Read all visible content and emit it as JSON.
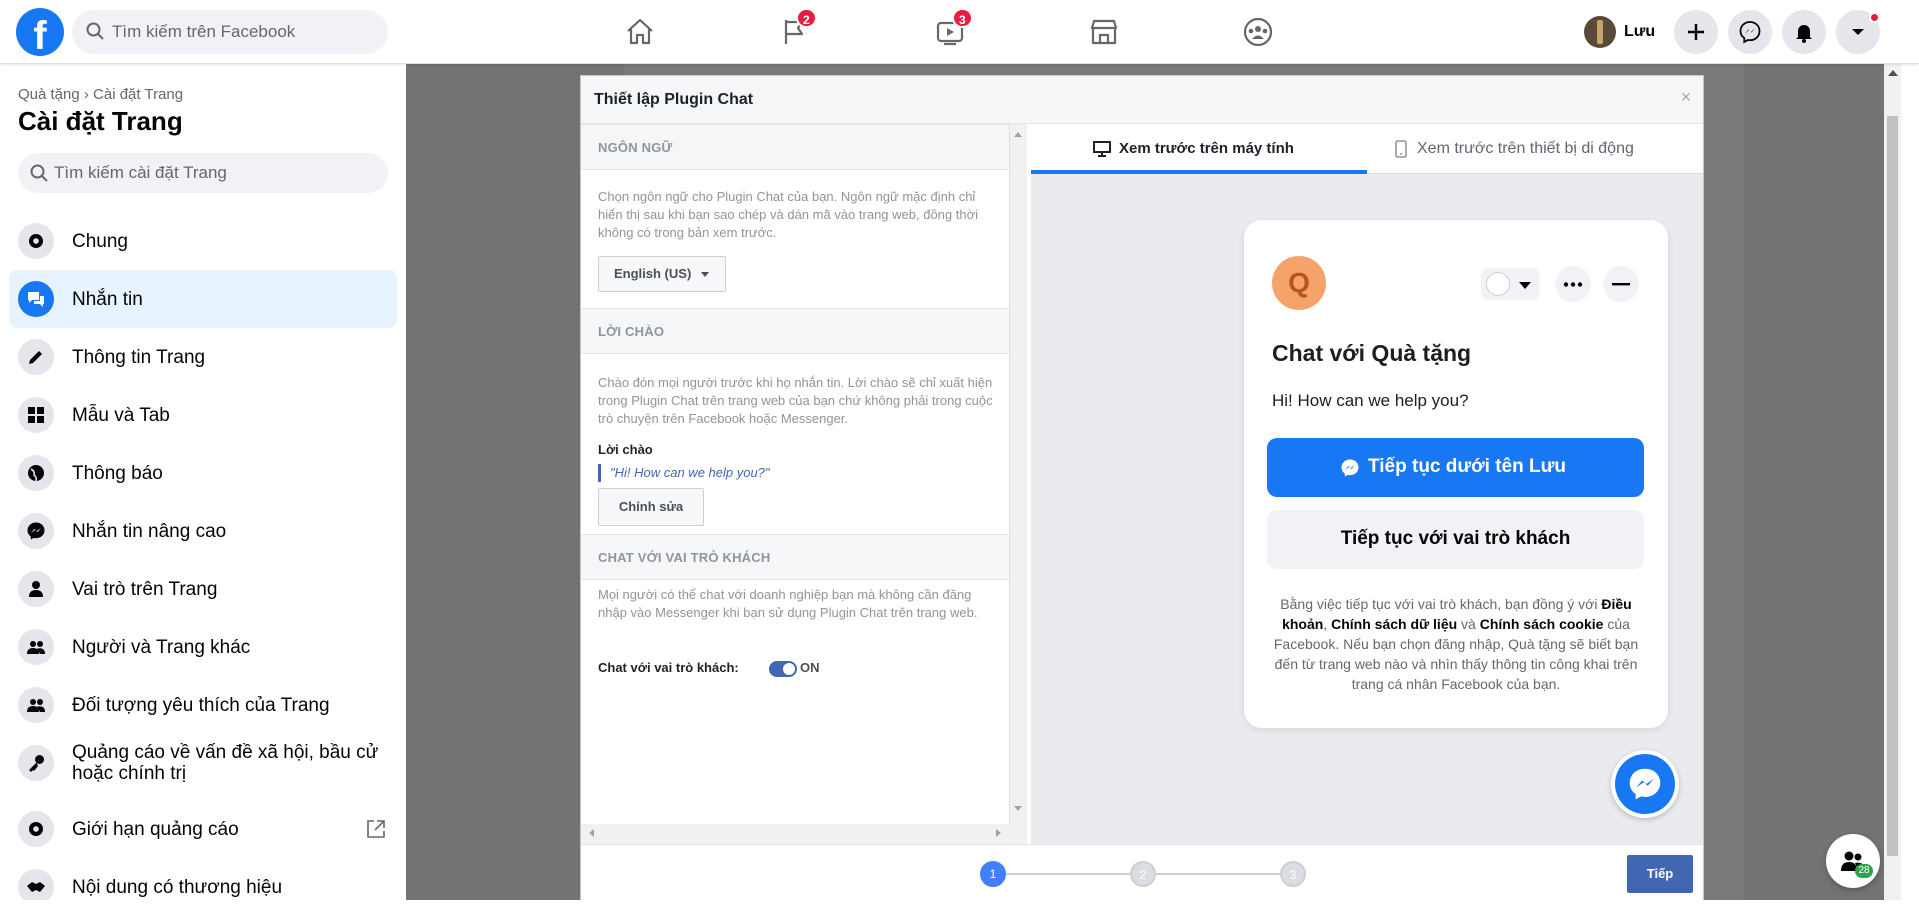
{
  "colors": {
    "brand": "#1877f2",
    "badge": "#e41e3f",
    "modal_primary": "#4267b2",
    "online": "#31a24c"
  },
  "topbar": {
    "logo_letter": "f",
    "search_placeholder": "Tìm kiếm trên Facebook",
    "nav": [
      {
        "icon": "home-icon",
        "badge": ""
      },
      {
        "icon": "flag-icon",
        "badge": "2"
      },
      {
        "icon": "watch-icon",
        "badge": "3"
      },
      {
        "icon": "marketplace-icon",
        "badge": ""
      },
      {
        "icon": "groups-icon",
        "badge": ""
      }
    ],
    "user_name": "Lưu",
    "actions": [
      "plus-icon",
      "messenger-icon",
      "bell-icon",
      "dropdown-icon"
    ]
  },
  "sidebar": {
    "breadcrumb": "Quà tặng › Cài đặt Trang",
    "title": "Cài đặt Trang",
    "search_placeholder": "Tìm kiếm cài đặt Trang",
    "items": [
      {
        "label": "Chung",
        "icon": "gear-icon",
        "active": false
      },
      {
        "label": "Nhắn tin",
        "icon": "chat-bubbles-icon",
        "active": true
      },
      {
        "label": "Thông tin Trang",
        "icon": "pencil-icon",
        "active": false
      },
      {
        "label": "Mẫu và Tab",
        "icon": "grid-icon",
        "active": false
      },
      {
        "label": "Thông báo",
        "icon": "globe-icon",
        "active": false
      },
      {
        "label": "Nhắn tin nâng cao",
        "icon": "messenger-icon",
        "active": false
      },
      {
        "label": "Vai trò trên Trang",
        "icon": "person-icon",
        "active": false
      },
      {
        "label": "Người và Trang khác",
        "icon": "people-icon",
        "active": false
      },
      {
        "label": "Đối tượng yêu thích của Trang",
        "icon": "people-icon",
        "active": false
      },
      {
        "label": "Quảng cáo về vấn đề xã hội, bầu cử hoặc chính trị",
        "icon": "key-icon",
        "active": false
      },
      {
        "label": "Giới hạn quảng cáo",
        "icon": "gear-icon",
        "active": false,
        "external": true
      },
      {
        "label": "Nội dung có thương hiệu",
        "icon": "handshake-icon",
        "active": false
      }
    ]
  },
  "modal": {
    "title": "Thiết lập Plugin Chat",
    "close_label": "×",
    "language": {
      "header": "NGÔN NGỮ",
      "description": "Chọn ngôn ngữ cho Plugin Chat của bạn. Ngôn ngữ mặc định chỉ hiển thị sau khi bạn sao chép và dán mã vào trang web, đồng thời không có trong bản xem trước.",
      "selected": "English (US)"
    },
    "greeting": {
      "header": "LỜI CHÀO",
      "description": "Chào đón mọi người trước khi họ nhắn tin. Lời chào sẽ chỉ xuất hiện trong Plugin Chat trên trang web của bạn chứ không phải trong cuộc trò chuyện trên Facebook hoặc Messenger.",
      "label": "Lời chào",
      "value": "\"Hi! How can we help you?\"",
      "edit_button": "Chỉnh sửa"
    },
    "guest": {
      "header": "CHAT VỚI VAI TRÒ KHÁCH",
      "description": "Mọi người có thể chat với doanh nghiệp bạn mà không cần đăng nhập vào Messenger khi bạn sử dụng Plugin Chat trên trang web.",
      "toggle_label": "Chat với vai trò khách:",
      "toggle_state": "ON"
    },
    "preview_tabs": [
      {
        "label": "Xem trước trên máy tính",
        "icon": "desktop-icon",
        "active": true
      },
      {
        "label": "Xem trước trên thiết bị di động",
        "icon": "mobile-icon",
        "active": false
      }
    ],
    "chat_preview": {
      "avatar_letter": "Q",
      "title": "Chat với Quà tặng",
      "greeting": "Hi! How can we help you?",
      "primary_button": "Tiếp tục dưới tên Lưu",
      "secondary_button": "Tiếp tục với vai trò khách",
      "legal_1": "Bằng việc tiếp tục với vai trò khách, bạn đồng ý với ",
      "legal_terms": "Điều khoản",
      "legal_2": ", ",
      "legal_data": "Chính sách dữ liệu",
      "legal_3": " và ",
      "legal_cookie": "Chính sách cookie",
      "legal_4": " của Facebook. Nếu bạn chọn đăng nhập, Quà tặng sẽ biết bạn đến từ trang web nào và nhìn thấy thông tin công khai trên trang cá nhân Facebook của bạn."
    },
    "steps": [
      "1",
      "2",
      "3"
    ],
    "current_step": 1,
    "next_button": "Tiếp"
  },
  "contacts": {
    "count": "28"
  }
}
